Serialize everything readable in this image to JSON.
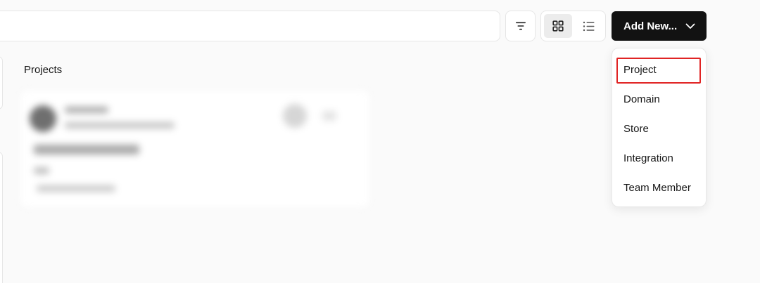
{
  "toolbar": {
    "search_value": "",
    "filter_icon": "filter-lines-icon",
    "view_modes": [
      "grid-view-icon",
      "list-view-icon"
    ],
    "active_view": "grid",
    "add_new_label": "Add New...",
    "add_new_icon": "chevron-down-icon"
  },
  "main": {
    "section_title": "Projects"
  },
  "dropdown": {
    "items": [
      {
        "label": "Project",
        "highlighted": true
      },
      {
        "label": "Domain"
      },
      {
        "label": "Store"
      },
      {
        "label": "Integration"
      },
      {
        "label": "Team Member"
      }
    ]
  },
  "colors": {
    "primary_button": "#121212",
    "highlight_border": "#e02424",
    "background": "#fafafa"
  }
}
